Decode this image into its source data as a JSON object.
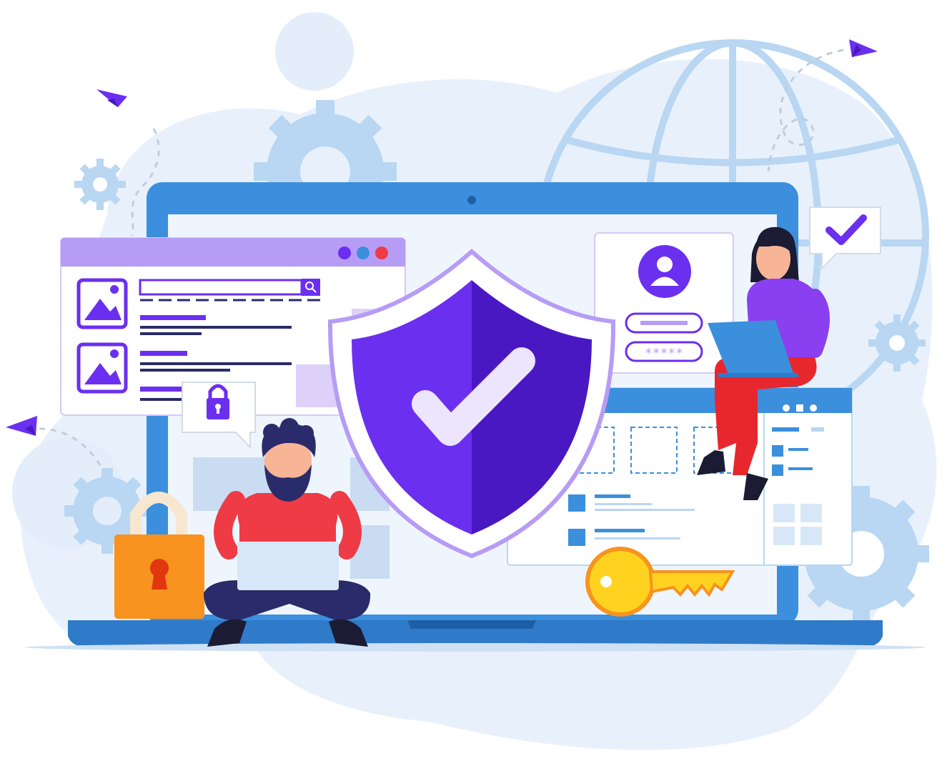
{
  "colors": {
    "blob": "#e8f1fb",
    "laptop_blue": "#3b8fdc",
    "laptop_dark": "#2f7bc9",
    "screen_bg": "#eef5fd",
    "purple": "#6b2ff0",
    "purple_dark": "#4a18c2",
    "lavender": "#b79cf5",
    "light_blue_line": "#b9d6f3",
    "padlock_orange": "#f7931e",
    "key_yellow": "#ffd21f",
    "shirt_red": "#ee3b45",
    "pants_navy": "#2a2b6a",
    "woman_top": "#8a3ff0",
    "woman_pants": "#e8262d"
  },
  "login_card": {
    "password_mask": "*****",
    "user_icon": "user-avatar-icon"
  },
  "icons": {
    "shield": "shield-check-icon",
    "padlock": "padlock-icon",
    "key": "key-icon",
    "globe": "globe-icon",
    "gear": "gear-icon",
    "paper_plane": "paper-plane-icon",
    "check_bubble": "check-speech-bubble-icon",
    "lock_bubble": "lock-speech-bubble-icon",
    "search": "search-icon",
    "image": "image-placeholder-icon"
  }
}
